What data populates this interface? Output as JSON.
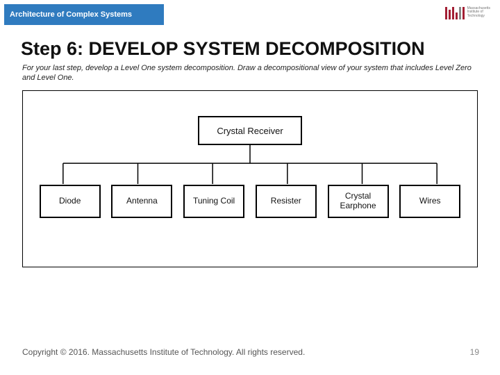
{
  "header": {
    "subject": "Architecture of Complex Systems"
  },
  "logo": {
    "org": "Massachusetts",
    "org2": "Institute of",
    "org3": "Technology"
  },
  "title": "Step 6: DEVELOP SYSTEM DECOMPOSITION",
  "instructions": "For your last step, develop a Level One system decomposition. Draw a decompositional view of your system that includes Level Zero and Level One.",
  "diagram": {
    "root": "Crystal Receiver",
    "children": [
      {
        "label": "Diode"
      },
      {
        "label": "Antenna"
      },
      {
        "label": "Tuning Coil"
      },
      {
        "label": "Resister"
      },
      {
        "label": "Crystal Earphone"
      },
      {
        "label": "Wires"
      }
    ]
  },
  "footer": "Copyright © 2016. Massachusetts Institute of Technology. All rights reserved.",
  "page": "19"
}
